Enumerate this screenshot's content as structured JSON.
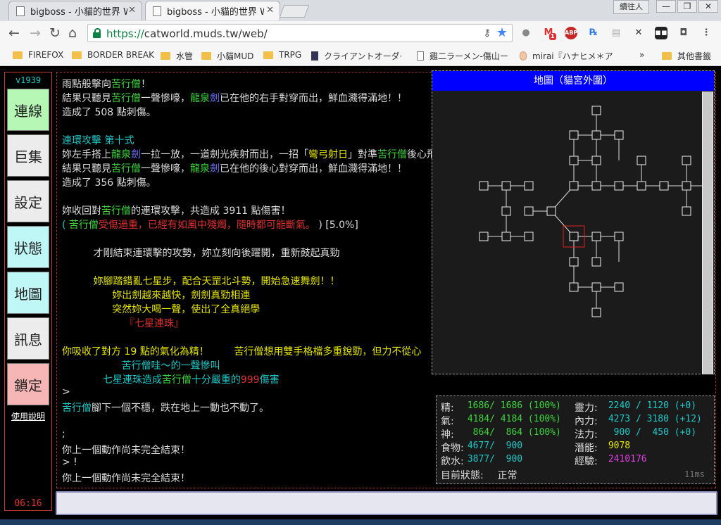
{
  "browser": {
    "tabs": [
      {
        "title": "bigboss - 小貓的世界 W",
        "active": false
      },
      {
        "title": "bigboss - 小貓的世界 W",
        "active": true
      }
    ],
    "user_button": "續往人",
    "window_buttons": [
      "—",
      "❐",
      "✕"
    ],
    "url_scheme": "https://",
    "url_rest": "catworld.muds.tw/web/",
    "extensions": [
      "speech-icon",
      "gmail-icon",
      "adblock-icon",
      "rx-icon",
      "reader-icon",
      "x-icon",
      "ghost-icon",
      "record-icon",
      "menu-icon"
    ],
    "gmail_badge": "1",
    "adblock_label": "ABP",
    "bookmarks": [
      {
        "label": "FIREFOX",
        "icon": "folder"
      },
      {
        "label": "BORDER BREAK",
        "icon": "folder"
      },
      {
        "label": "水管",
        "icon": "folder"
      },
      {
        "label": "小貓MUD",
        "icon": "folder"
      },
      {
        "label": "TRPG",
        "icon": "folder"
      },
      {
        "label": "クライアントオーダ·",
        "icon": "app"
      },
      {
        "label": "雞二ラーメン-傷山ー",
        "icon": "page"
      },
      {
        "label": "mirai『ハナヒメ＊ア",
        "icon": "avatar"
      }
    ],
    "bookmarks_more": "»",
    "other_bookmarks": "其他書籤"
  },
  "sidebar": {
    "version": "v1939",
    "buttons": [
      {
        "label": "連線",
        "color": "#b6f7b6"
      },
      {
        "label": "巨集",
        "color": "#ececec"
      },
      {
        "label": "設定",
        "color": "#ececec"
      },
      {
        "label": "狀態",
        "color": "#bff6f6"
      },
      {
        "label": "地圖",
        "color": "#bff6f6"
      },
      {
        "label": "訊息",
        "color": "#ececec"
      },
      {
        "label": "鎖定",
        "color": "#f6b6b6"
      }
    ],
    "help": "使用說明",
    "clock": "06:16"
  },
  "console": {
    "lines": [
      {
        "spans": [
          [
            "雨點般擊向",
            "w"
          ],
          [
            "苦行僧",
            "g"
          ],
          [
            "！",
            "w"
          ]
        ]
      },
      {
        "spans": [
          [
            "結果只聽見",
            "w"
          ],
          [
            "苦行僧",
            "g"
          ],
          [
            "一聲慘嚎，",
            "w"
          ],
          [
            "龍泉",
            "g"
          ],
          [
            "劍",
            "b"
          ],
          [
            "已在他的右手對穿而出，鮮血濺得滿地！！",
            "w"
          ]
        ]
      },
      {
        "spans": [
          [
            "造成了 508 點刺傷。",
            "w"
          ]
        ]
      },
      {
        "spans": []
      },
      {
        "spans": [
          [
            "連環攻擊 第十式",
            "c"
          ]
        ]
      },
      {
        "spans": [
          [
            "妳左手搭上",
            "w"
          ],
          [
            "龍泉",
            "g"
          ],
          [
            "劍",
            "b"
          ],
          [
            "一拉一放，一道劍光疾射而出，一招「",
            "w"
          ],
          [
            "彎弓射日",
            "y"
          ],
          [
            "」對準",
            "w"
          ],
          [
            "苦行僧",
            "g"
          ],
          [
            "後心飛去！",
            "w"
          ]
        ]
      },
      {
        "spans": [
          [
            "結果只聽見",
            "w"
          ],
          [
            "苦行僧",
            "g"
          ],
          [
            "一聲慘嚎，",
            "w"
          ],
          [
            "龍泉",
            "g"
          ],
          [
            "劍",
            "b"
          ],
          [
            "已在他的後心對穿而出，鮮血濺得滿地！！",
            "w"
          ]
        ]
      },
      {
        "spans": [
          [
            "造成了 356 點刺傷。",
            "w"
          ]
        ]
      },
      {
        "spans": []
      },
      {
        "spans": [
          [
            "妳收回對",
            "w"
          ],
          [
            "苦行僧",
            "g"
          ],
          [
            "的連環攻擊，共造成 3911 點傷害！",
            "w"
          ]
        ]
      },
      {
        "spans": [
          [
            "( ",
            "c"
          ],
          [
            "苦行僧",
            "g"
          ],
          [
            "受傷過重，已經有如風中殘燭，隨時都可能斷氣。",
            "r"
          ],
          [
            " ) [5.0%]",
            "w"
          ]
        ]
      },
      {
        "spans": []
      },
      {
        "spans": [
          [
            "          才剛結束連環擊的攻勢，妳立刻向後躍開，重新鼓起真勁",
            "w"
          ]
        ]
      },
      {
        "spans": []
      },
      {
        "spans": [
          [
            "          妳腳踏錯亂七星步，配合天罡北斗勢，開始急速舞劍！！",
            "y"
          ]
        ]
      },
      {
        "spans": [
          [
            "                妳出劍越來越快，劍劍真勁相連",
            "y"
          ]
        ]
      },
      {
        "spans": [
          [
            "                突然妳大喝一聲，使出了全真絕學",
            "y"
          ]
        ]
      },
      {
        "spans": [
          [
            "                    『七星連珠』",
            "r"
          ]
        ]
      },
      {
        "spans": []
      },
      {
        "spans": [
          [
            "你吸收了對方 19 點的氣化為精！",
            "y"
          ],
          [
            "        苦行僧想用雙手格檔多重銳勁，但力不從心",
            "y"
          ]
        ]
      },
      {
        "spans": [
          [
            "                   ",
            "w"
          ],
          [
            "苦行僧哇～的一聲慘叫",
            "c"
          ]
        ]
      },
      {
        "spans": [
          [
            "             七星連珠造成",
            "c"
          ],
          [
            "苦行僧",
            "g"
          ],
          [
            "十分嚴重的",
            "c"
          ],
          [
            "999",
            "r"
          ],
          [
            "傷害",
            "c"
          ]
        ]
      },
      {
        "spans": [
          [
            ">",
            "w"
          ]
        ]
      },
      {
        "spans": [
          [
            "苦行僧",
            "c"
          ],
          [
            "腳下一個不穩，跌在地上一動也不動了。",
            "w"
          ]
        ]
      },
      {
        "spans": []
      },
      {
        "spans": [
          [
            ";",
            "w"
          ]
        ]
      },
      {
        "spans": [
          [
            "你上一個動作尚未完全結束！",
            "w"
          ]
        ]
      },
      {
        "spans": [
          [
            "> !",
            "w"
          ]
        ]
      },
      {
        "spans": [
          [
            "你上一個動作尚未完全結束！",
            "w"
          ]
        ]
      }
    ]
  },
  "map": {
    "title": "地圖（貓宮外圍）"
  },
  "stats": {
    "rows": [
      {
        "l_label": "精:",
        "l_value": " 1686/ 1686 (100%)",
        "l_color": "#3dd63d",
        "r_label": "靈力:",
        "r_value": " 2240 / 1120 (+0)",
        "r_color": "#1ec8c8"
      },
      {
        "l_label": "氣:",
        "l_value": " 4184/ 4184 (100%)",
        "l_color": "#3dd63d",
        "r_label": "內力:",
        "r_value": " 4273 / 3180 (+12)",
        "r_color": "#1ec8c8"
      },
      {
        "l_label": "神:",
        "l_value": "  864/  864 (100%)",
        "l_color": "#3dd63d",
        "r_label": "法力:",
        "r_value": "  900 /  450 (+0)",
        "r_color": "#1ec8c8"
      },
      {
        "l_label": "食物:",
        "l_value": " 4677/  900",
        "l_color": "#1ec8c8",
        "r_label": "潛能:",
        "r_value": " 9078",
        "r_color": "#e6e600"
      },
      {
        "l_label": "飲水:",
        "l_value": " 3877/  900",
        "l_color": "#1ec8c8",
        "r_label": "經驗:",
        "r_value": " 2410176",
        "r_color": "#e040e0"
      }
    ],
    "state_label": "目前狀態:",
    "state_value": " 正常",
    "ping": "11ms"
  }
}
